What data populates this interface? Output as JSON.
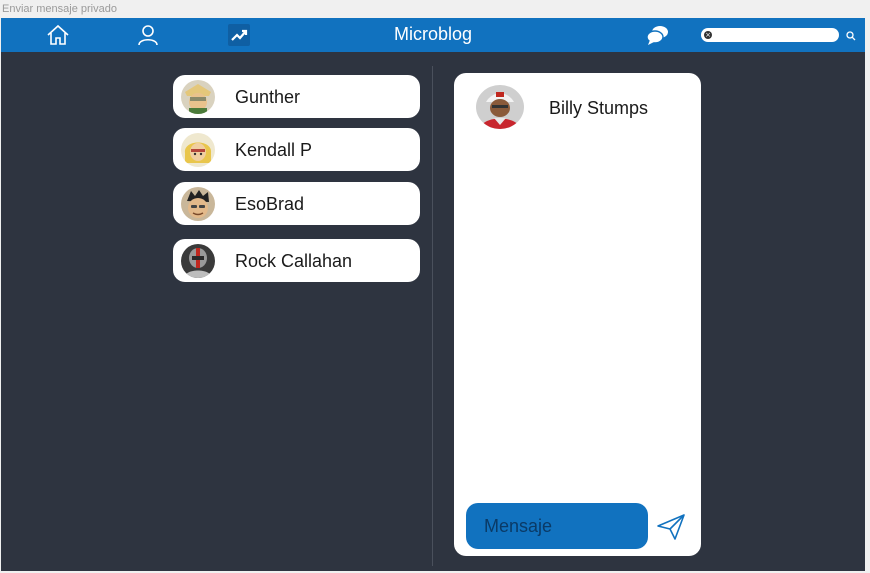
{
  "window": {
    "caption": "Enviar mensaje privado"
  },
  "header": {
    "title": "Microblog",
    "nav": [
      {
        "icon": "home-icon"
      },
      {
        "icon": "user-icon"
      },
      {
        "icon": "trending-icon"
      }
    ],
    "messages_icon": "chat-bubbles-icon",
    "search": {
      "value": "",
      "placeholder": ""
    }
  },
  "contacts": [
    {
      "name": "Gunther"
    },
    {
      "name": "Kendall P"
    },
    {
      "name": "EsoBrad"
    },
    {
      "name": "Rock Callahan"
    }
  ],
  "chat": {
    "recipient": "Billy Stumps",
    "input": {
      "placeholder": "Mensaje",
      "value": ""
    },
    "send_icon": "send-icon"
  },
  "colors": {
    "accent": "#1172bf",
    "background": "#2e3440",
    "card": "#ffffff"
  }
}
